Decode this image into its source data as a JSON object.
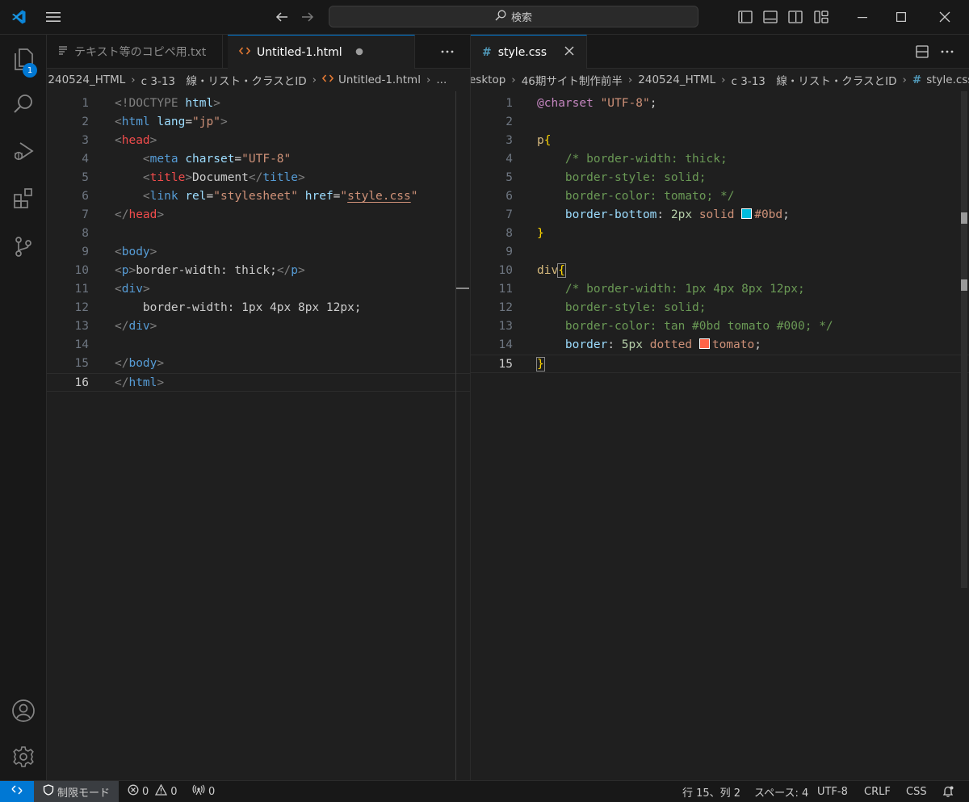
{
  "titlebar": {
    "search_placeholder": "検索"
  },
  "activity_bar": {
    "explorer_badge": "1"
  },
  "left_editor": {
    "tabs": [
      {
        "label": "テキスト等のコピペ用.txt",
        "icon": "text-file-icon",
        "state": "inactive"
      },
      {
        "label": "Untitled-1.html",
        "icon": "html-file-icon",
        "state": "active-unsaved"
      }
    ],
    "breadcrumbs": [
      "240524_HTML",
      "c 3-13　線・リスト・クラスとID",
      "Untitled-1.html",
      "..."
    ],
    "current_line": 16,
    "lines": [
      {
        "num": "1",
        "parts": [
          {
            "t": "<!DOCTYPE ",
            "c": "#808080"
          },
          {
            "t": "html",
            "c": "#9cdcfe"
          },
          {
            "t": ">",
            "c": "#808080"
          }
        ]
      },
      {
        "num": "2",
        "parts": [
          {
            "t": "<",
            "c": "#808080"
          },
          {
            "t": "html",
            "c": "#569cd6"
          },
          {
            "t": " ",
            "c": "#cccccc"
          },
          {
            "t": "lang",
            "c": "#9cdcfe"
          },
          {
            "t": "=",
            "c": "#cccccc"
          },
          {
            "t": "\"jp\"",
            "c": "#ce9178"
          },
          {
            "t": ">",
            "c": "#808080"
          }
        ]
      },
      {
        "num": "3",
        "parts": [
          {
            "t": "<",
            "c": "#808080"
          },
          {
            "t": "head",
            "c": "#f14c4c"
          },
          {
            "t": ">",
            "c": "#808080"
          }
        ]
      },
      {
        "num": "4",
        "parts": [
          {
            "t": "    <",
            "c": "#808080"
          },
          {
            "t": "meta",
            "c": "#569cd6"
          },
          {
            "t": " ",
            "c": "#cccccc"
          },
          {
            "t": "charset",
            "c": "#9cdcfe"
          },
          {
            "t": "=",
            "c": "#cccccc"
          },
          {
            "t": "\"UTF-8\"",
            "c": "#ce9178"
          }
        ]
      },
      {
        "num": "5",
        "parts": [
          {
            "t": "    <",
            "c": "#808080"
          },
          {
            "t": "title",
            "c": "#f14c4c"
          },
          {
            "t": ">",
            "c": "#808080"
          },
          {
            "t": "Document",
            "c": "#cccccc"
          },
          {
            "t": "</",
            "c": "#808080"
          },
          {
            "t": "title",
            "c": "#569cd6"
          },
          {
            "t": ">",
            "c": "#808080"
          }
        ]
      },
      {
        "num": "6",
        "parts": [
          {
            "t": "    <",
            "c": "#808080"
          },
          {
            "t": "link",
            "c": "#569cd6"
          },
          {
            "t": " ",
            "c": "#cccccc"
          },
          {
            "t": "rel",
            "c": "#9cdcfe"
          },
          {
            "t": "=",
            "c": "#cccccc"
          },
          {
            "t": "\"stylesheet\"",
            "c": "#ce9178"
          },
          {
            "t": " ",
            "c": "#cccccc"
          },
          {
            "t": "href",
            "c": "#9cdcfe"
          },
          {
            "t": "=",
            "c": "#cccccc"
          },
          {
            "t": "\"",
            "c": "#ce9178"
          },
          {
            "t": "style.css",
            "c": "#ce9178",
            "u": true
          },
          {
            "t": "\"",
            "c": "#ce9178"
          }
        ]
      },
      {
        "num": "7",
        "parts": [
          {
            "t": "</",
            "c": "#808080"
          },
          {
            "t": "head",
            "c": "#f14c4c"
          },
          {
            "t": ">",
            "c": "#808080"
          }
        ]
      },
      {
        "num": "8",
        "parts": []
      },
      {
        "num": "9",
        "parts": [
          {
            "t": "<",
            "c": "#808080"
          },
          {
            "t": "body",
            "c": "#569cd6"
          },
          {
            "t": ">",
            "c": "#808080"
          }
        ]
      },
      {
        "num": "10",
        "parts": [
          {
            "t": "<",
            "c": "#808080"
          },
          {
            "t": "p",
            "c": "#569cd6"
          },
          {
            "t": ">",
            "c": "#808080"
          },
          {
            "t": "border-width: thick;",
            "c": "#cccccc"
          },
          {
            "t": "</",
            "c": "#808080"
          },
          {
            "t": "p",
            "c": "#569cd6"
          },
          {
            "t": ">",
            "c": "#808080"
          }
        ]
      },
      {
        "num": "11",
        "parts": [
          {
            "t": "<",
            "c": "#808080"
          },
          {
            "t": "div",
            "c": "#569cd6"
          },
          {
            "t": ">",
            "c": "#808080"
          }
        ]
      },
      {
        "num": "12",
        "parts": [
          {
            "t": "    border-width: 1px 4px 8px 12px;",
            "c": "#cccccc"
          }
        ]
      },
      {
        "num": "13",
        "parts": [
          {
            "t": "</",
            "c": "#808080"
          },
          {
            "t": "div",
            "c": "#569cd6"
          },
          {
            "t": ">",
            "c": "#808080"
          }
        ]
      },
      {
        "num": "14",
        "parts": []
      },
      {
        "num": "15",
        "parts": [
          {
            "t": "</",
            "c": "#808080"
          },
          {
            "t": "body",
            "c": "#569cd6"
          },
          {
            "t": ">",
            "c": "#808080"
          }
        ]
      },
      {
        "num": "16",
        "parts": [
          {
            "t": "</",
            "c": "#808080"
          },
          {
            "t": "html",
            "c": "#569cd6"
          },
          {
            "t": ">",
            "c": "#808080"
          }
        ]
      }
    ]
  },
  "right_editor": {
    "tabs": [
      {
        "label": "style.css",
        "icon": "css-file-icon",
        "state": "active"
      }
    ],
    "breadcrumbs": [
      "esktop",
      "46期サイト制作前半",
      "240524_HTML",
      "c 3-13　線・リスト・クラスとID",
      "style.css"
    ],
    "current_line": 15,
    "lines": [
      {
        "num": "1",
        "parts": [
          {
            "t": "@charset",
            "c": "#c586c0"
          },
          {
            "t": " ",
            "c": "#cccccc"
          },
          {
            "t": "\"UTF-8\"",
            "c": "#ce9178"
          },
          {
            "t": ";",
            "c": "#cccccc"
          }
        ]
      },
      {
        "num": "2",
        "parts": []
      },
      {
        "num": "3",
        "parts": [
          {
            "t": "p",
            "c": "#d7ba7d"
          },
          {
            "t": "{",
            "c": "#ffd700"
          }
        ]
      },
      {
        "num": "4",
        "parts": [
          {
            "t": "    /* border-width: thick;",
            "c": "#6a9955"
          }
        ]
      },
      {
        "num": "5",
        "parts": [
          {
            "t": "    border-style: solid;",
            "c": "#6a9955"
          }
        ]
      },
      {
        "num": "6",
        "parts": [
          {
            "t": "    border-color: tomato; */",
            "c": "#6a9955"
          }
        ]
      },
      {
        "num": "7",
        "parts": [
          {
            "t": "    ",
            "c": "#cccccc"
          },
          {
            "t": "border-bottom",
            "c": "#9cdcfe"
          },
          {
            "t": ": ",
            "c": "#cccccc"
          },
          {
            "t": "2px",
            "c": "#b5cea8"
          },
          {
            "t": " ",
            "c": "#cccccc"
          },
          {
            "t": "solid",
            "c": "#ce9178"
          },
          {
            "t": " ",
            "c": "#cccccc"
          },
          {
            "s": "#00bbdd"
          },
          {
            "t": "#0bd",
            "c": "#ce9178"
          },
          {
            "t": ";",
            "c": "#cccccc"
          }
        ]
      },
      {
        "num": "8",
        "parts": [
          {
            "t": "}",
            "c": "#ffd700"
          }
        ]
      },
      {
        "num": "9",
        "parts": []
      },
      {
        "num": "10",
        "parts": [
          {
            "t": "div",
            "c": "#d7ba7d"
          },
          {
            "t": "{",
            "c": "#ffd700",
            "b": true
          }
        ]
      },
      {
        "num": "11",
        "parts": [
          {
            "t": "    /* border-width: 1px 4px 8px 12px;",
            "c": "#6a9955"
          }
        ]
      },
      {
        "num": "12",
        "parts": [
          {
            "t": "    border-style: solid;",
            "c": "#6a9955"
          }
        ]
      },
      {
        "num": "13",
        "parts": [
          {
            "t": "    border-color: tan #0bd tomato #000; */",
            "c": "#6a9955"
          }
        ]
      },
      {
        "num": "14",
        "parts": [
          {
            "t": "    ",
            "c": "#cccccc"
          },
          {
            "t": "border",
            "c": "#9cdcfe"
          },
          {
            "t": ": ",
            "c": "#cccccc"
          },
          {
            "t": "5px",
            "c": "#b5cea8"
          },
          {
            "t": " ",
            "c": "#cccccc"
          },
          {
            "t": "dotted",
            "c": "#ce9178"
          },
          {
            "t": " ",
            "c": "#cccccc"
          },
          {
            "s": "#ff6347"
          },
          {
            "t": "tomato",
            "c": "#ce9178"
          },
          {
            "t": ";",
            "c": "#cccccc"
          }
        ]
      },
      {
        "num": "15",
        "parts": [
          {
            "t": "}",
            "c": "#ffd700",
            "b": true
          }
        ]
      }
    ]
  },
  "statusbar": {
    "restricted_mode": "制限モード",
    "errors": "0",
    "warnings": "0",
    "ports": "0",
    "cursor_position": "行 15、列 2",
    "indentation": "スペース: 4",
    "encoding": "UTF-8",
    "line_ending": "CRLF",
    "language": "CSS"
  },
  "colors": {
    "accent": "#0078d4",
    "background": "#1f1f1f",
    "chrome": "#181818"
  }
}
